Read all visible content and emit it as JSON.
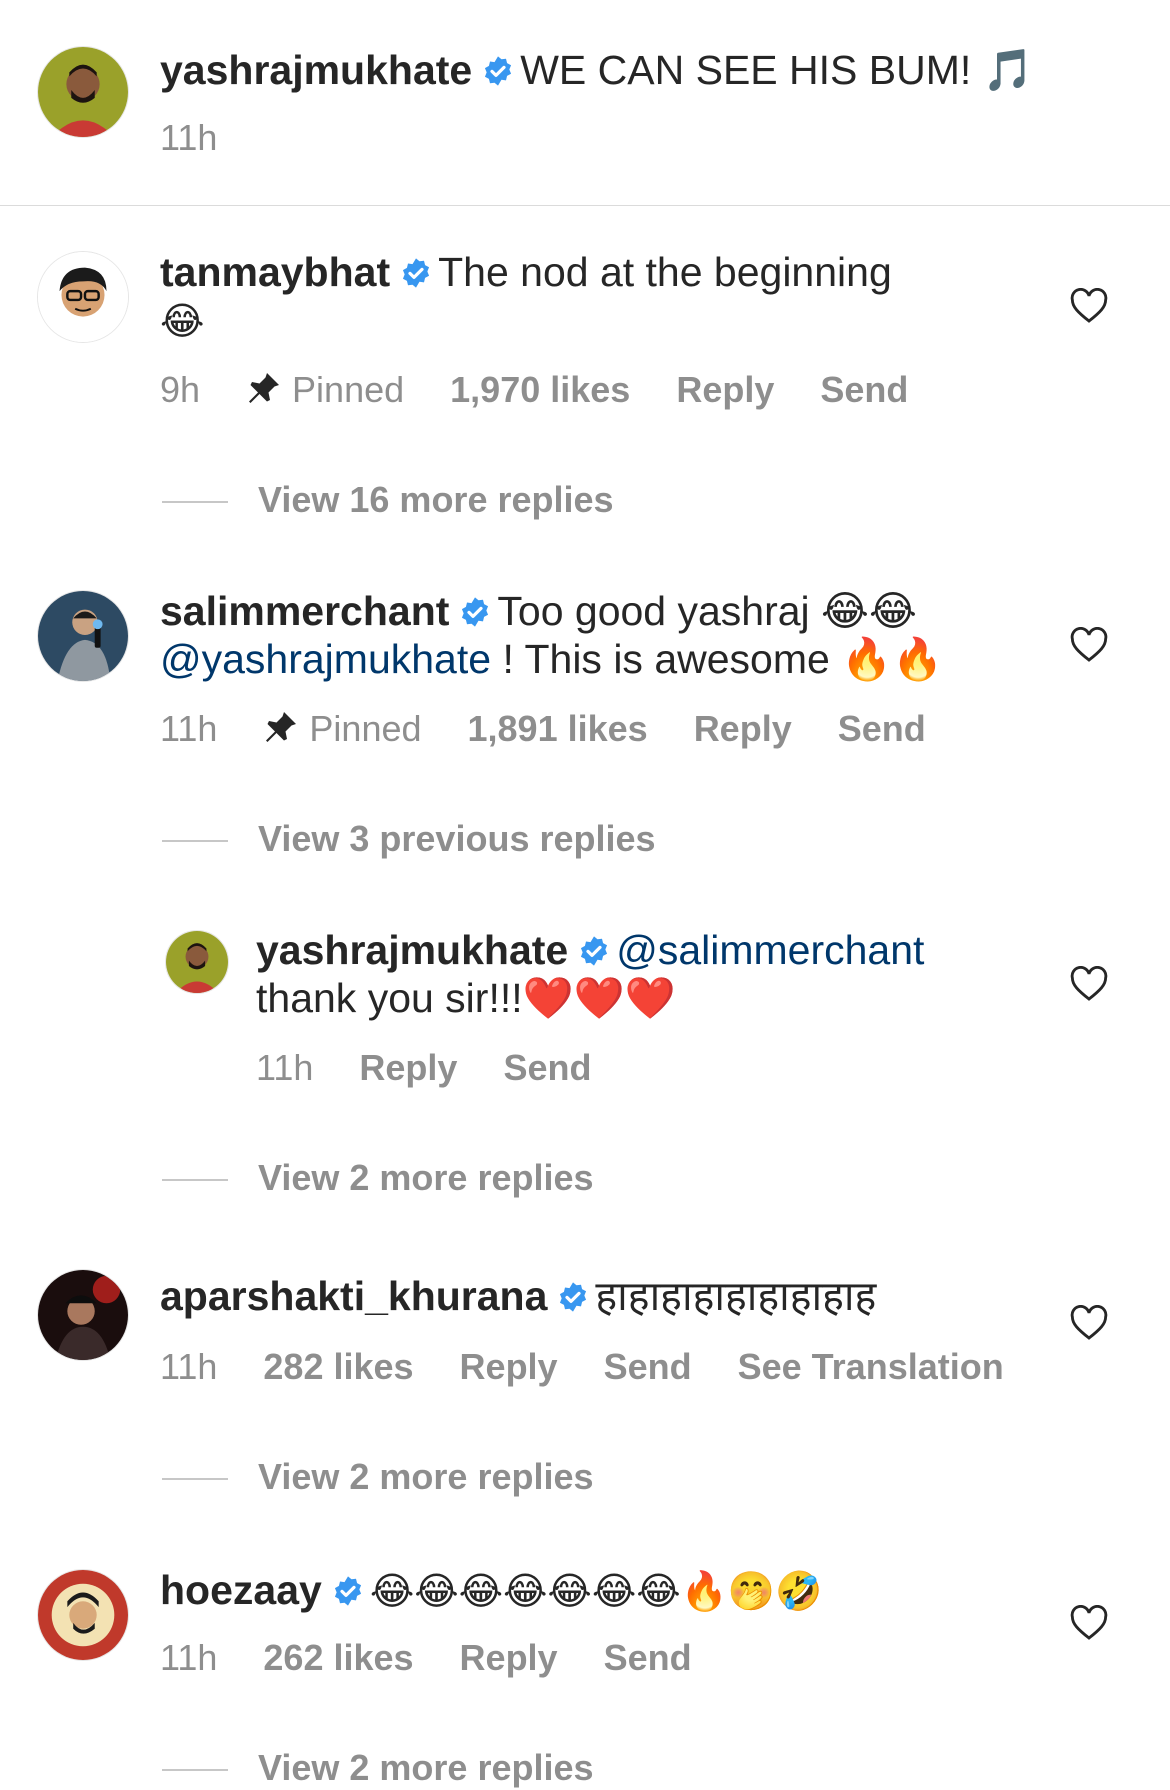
{
  "colors": {
    "text": "#262626",
    "meta": "#8e8e8e",
    "mention": "#00376b",
    "verified": "#3897f0",
    "divider": "#dbdbdb"
  },
  "caption": {
    "username": "yashrajmukhate",
    "text": "WE CAN SEE HIS BUM! 🎵",
    "time": "11h"
  },
  "comments": [
    {
      "username": "tanmaybhat",
      "text": "The nod at the beginning",
      "emoji": "😂",
      "time": "9h",
      "pinned": "Pinned",
      "likes": "1,970 likes",
      "reply": "Reply",
      "send": "Send",
      "view_more": "View 16 more replies"
    },
    {
      "username": "salimmerchant",
      "text": "Too good yashraj 😂😂",
      "mention": "@yashrajmukhate",
      "text2": " ! This is awesome 🔥🔥",
      "time": "11h",
      "pinned": "Pinned",
      "likes": "1,891 likes",
      "reply": "Reply",
      "send": "Send",
      "view_previous": "View 3 previous replies",
      "reply_item": {
        "username": "yashrajmukhate",
        "mention": "@salimmerchant",
        "text": "thank you sir!!!❤️❤️❤️",
        "time": "11h",
        "reply": "Reply",
        "send": "Send"
      },
      "view_more": "View 2 more replies"
    },
    {
      "username": "aparshakti_khurana",
      "text": "हाहाहाहाहाहाहाहाह",
      "time": "11h",
      "likes": "282 likes",
      "reply": "Reply",
      "send": "Send",
      "translation": "See Translation",
      "view_more": "View 2 more replies"
    },
    {
      "username": "hoezaay",
      "text": "😂😂😂😂😂😂😂🔥🤭🤣",
      "time": "11h",
      "likes": "262 likes",
      "reply": "Reply",
      "send": "Send",
      "view_more": "View 2 more replies"
    }
  ]
}
